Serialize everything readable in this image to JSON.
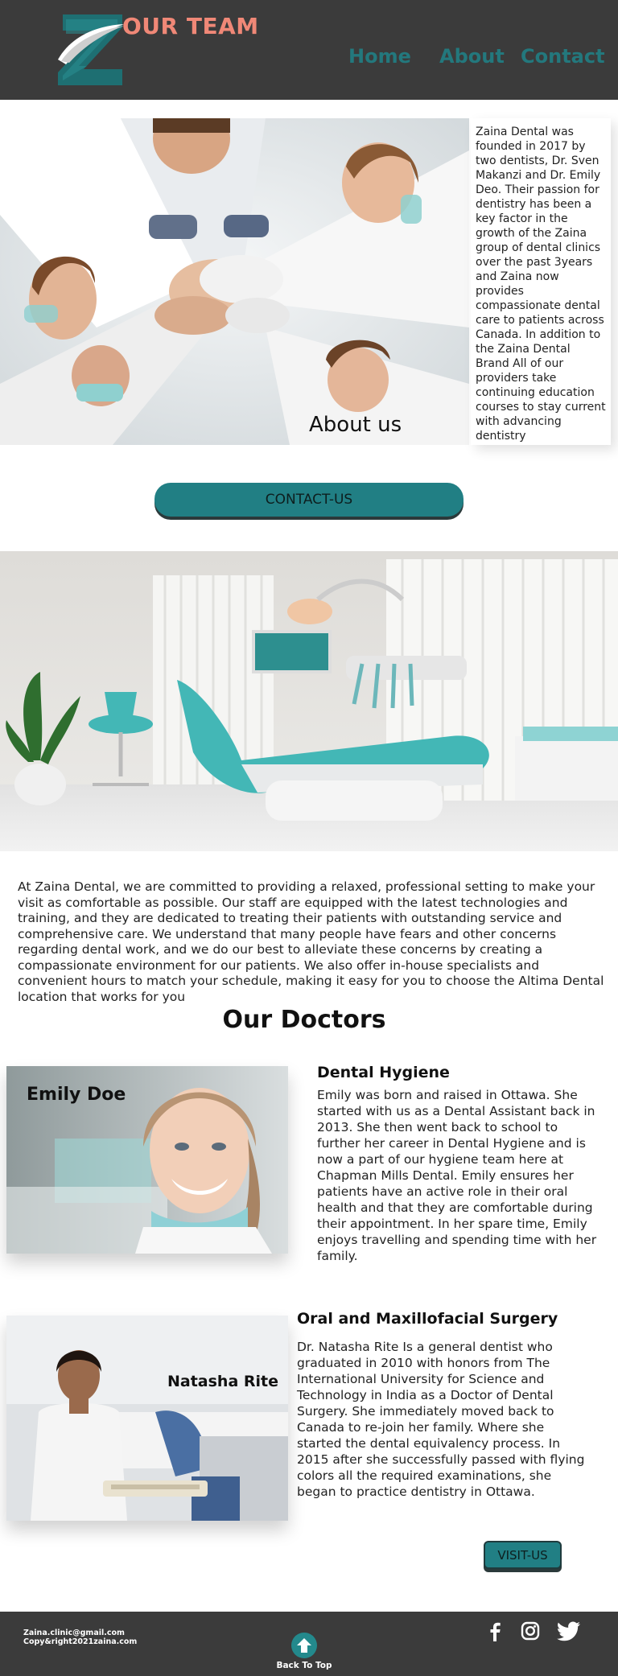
{
  "header": {
    "site_title": "OUR TEAM",
    "nav": [
      {
        "label": "Home"
      },
      {
        "label": "About"
      },
      {
        "label": "Contact"
      }
    ]
  },
  "about": {
    "heading": "About us",
    "text": "Zaina Dental was founded in 2017 by two dentists, Dr. Sven Makanzi and Dr. Emily Deo. Their passion for dentistry has been a key factor in the growth of the Zaina group of dental clinics over the past 3years and Zaina now provides compassionate dental care to patients across Canada. In addition to the Zaina Dental Brand All of our providers take continuing education courses to stay current with advancing dentistry",
    "contact_button": "CONTACT-US"
  },
  "intro": "At Zaina Dental, we are committed to providing a relaxed, professional setting to make your visit as comfortable as possible. Our staff are equipped with the latest technologies and training, and they are dedicated to treating their patients with outstanding service and comprehensive care. We understand that many people have fears and other concerns regarding dental work, and we do our best to alleviate these concerns by creating a compassionate environment for our patients. We also offer in-house specialists and convenient hours to match your schedule, making it easy for you to choose the Altima Dental location that works for you",
  "doctors": {
    "title": "Our Doctors",
    "list": [
      {
        "name": "Emily Doe",
        "specialty": "Dental Hygiene",
        "bio": "Emily was born and raised in Ottawa. She started with us as a Dental Assistant back in 2013. She then went back to school to further her career in Dental Hygiene and is now a part of our hygiene team here at Chapman Mills Dental. Emily ensures her patients have an active role in their oral health and that they are comfortable during their appointment. In her spare time, Emily enjoys travelling and spending time with her family."
      },
      {
        "name": "Natasha Rite",
        "specialty": "Oral and Maxillofacial Surgery",
        "bio": "Dr. Natasha Rite Is a general dentist who graduated in 2010 with honors from The International University for Science and Technology in India as a Doctor of Dental Surgery. She immediately moved back to Canada to re-join her family. Where she started the dental equivalency process. In 2015 after she successfully passed with flying colors all the required examinations, she began to practice dentistry in Ottawa."
      }
    ],
    "visit_button": "VISIT-US"
  },
  "footer": {
    "email": "Zaina.clinic@gmail.com",
    "copyright": "Copy&right2021zaina.com",
    "back_to_top": "Back To Top",
    "social": [
      "facebook-icon",
      "instagram-icon",
      "twitter-icon"
    ]
  },
  "colors": {
    "header_bg": "#3b3b3b",
    "accent_teal": "#217f84",
    "title_coral": "#f08877"
  }
}
